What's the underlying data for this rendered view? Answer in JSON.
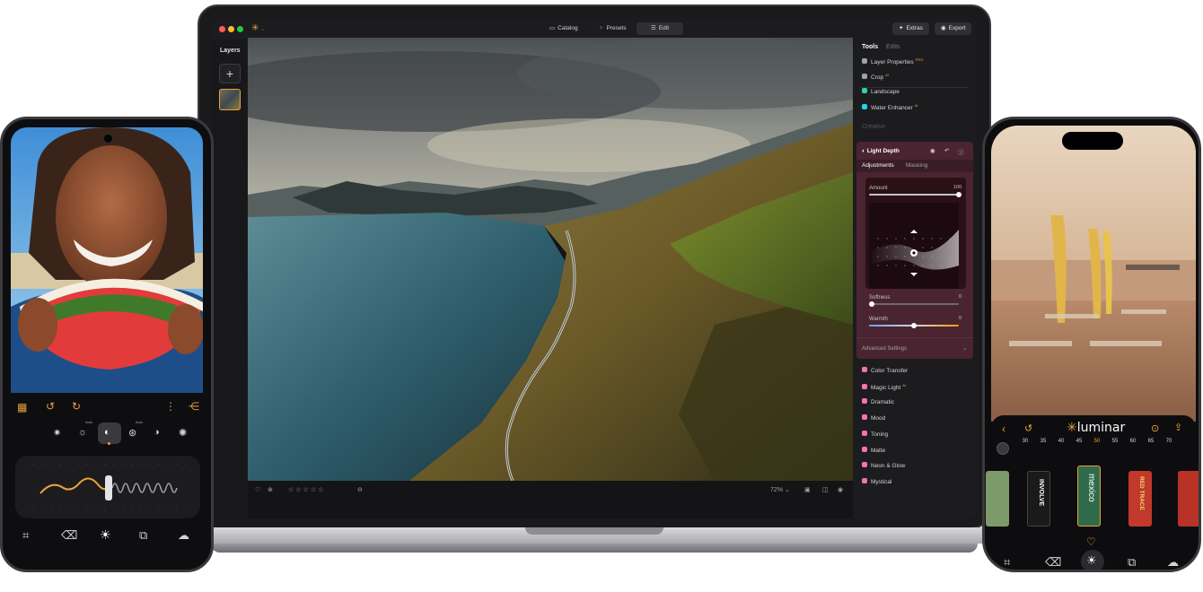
{
  "laptop": {
    "tabs": [
      {
        "label": "Catalog"
      },
      {
        "label": "Presets"
      },
      {
        "label": "Edit"
      }
    ],
    "right_buttons": {
      "extras": "Extras",
      "export": "Export"
    },
    "layers": {
      "title": "Layers",
      "add": "+"
    },
    "bottombar": {
      "zoom": "72% ⌄"
    },
    "panel": {
      "tab_tools": "Tools",
      "tab_edits": "Edits",
      "items_top": [
        {
          "label": "Layer Properties",
          "badge": "PRO",
          "color": "#9ca3af"
        },
        {
          "label": "Crop",
          "badge": "AI",
          "color": "#9ca3af"
        },
        {
          "label": "Landscape",
          "badge": "",
          "color": "#34d399"
        },
        {
          "label": "Water Enhancer",
          "badge": "AI",
          "color": "#22d3ee"
        }
      ],
      "section_creative": "Creative",
      "light_depth": {
        "title": "Light Depth",
        "tab_adjustments": "Adjustments",
        "tab_masking": "Masking",
        "amount_label": "Amount",
        "amount_value": "100",
        "softness_label": "Softness",
        "softness_value": "0",
        "warmth_label": "Warmth",
        "warmth_value": "0",
        "advanced": "Advanced Settings"
      },
      "items_creative": [
        {
          "label": "Color Transfer",
          "badge": "",
          "color": "#f472b6"
        },
        {
          "label": "Magic Light",
          "badge": "AI",
          "color": "#f472b6"
        },
        {
          "label": "Dramatic",
          "badge": "",
          "color": "#f472b6"
        },
        {
          "label": "Mood",
          "badge": "",
          "color": "#f472b6"
        },
        {
          "label": "Toning",
          "badge": "",
          "color": "#f472b6"
        },
        {
          "label": "Matte",
          "badge": "",
          "color": "#f472b6"
        },
        {
          "label": "Neon & Glow",
          "badge": "",
          "color": "#f472b6"
        },
        {
          "label": "Mystical",
          "badge": "",
          "color": "#f472b6"
        }
      ]
    }
  },
  "left_phone": {
    "tool_labels": [
      "Auto",
      "Auto"
    ]
  },
  "right_phone": {
    "brand": "luminar",
    "dial_values": [
      "30",
      "35",
      "40",
      "45",
      "50",
      "55",
      "60",
      "65",
      "70"
    ],
    "dial_active": "50",
    "films": [
      "INVOLVE",
      "mexico",
      "RED TRACE"
    ]
  },
  "colors": {
    "accent": "#e9a23b",
    "card": "#4a2430",
    "panel": "#1c1c1f"
  }
}
